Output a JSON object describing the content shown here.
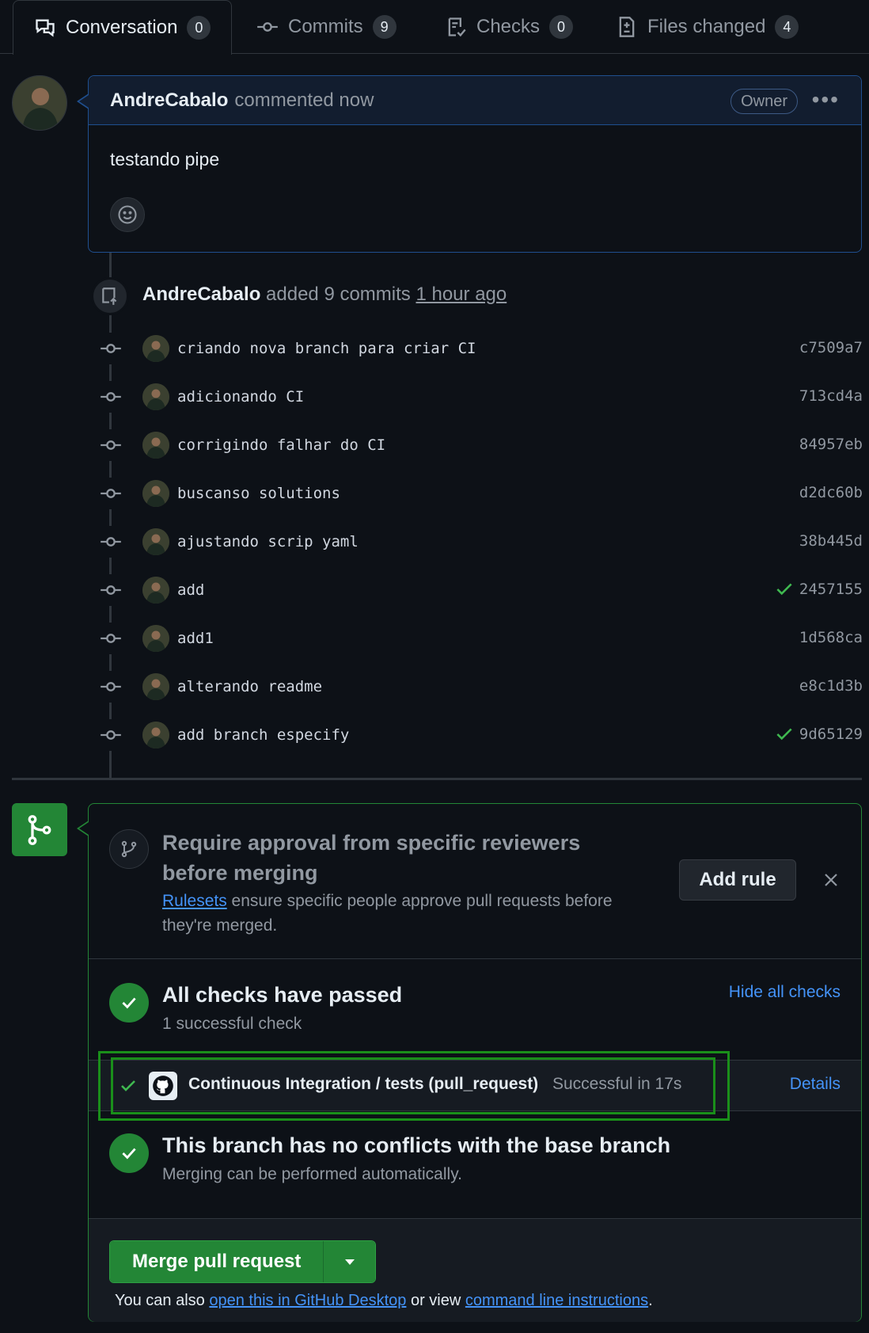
{
  "tabs": [
    {
      "label": "Conversation",
      "count": "0",
      "icon": "comment-discussion-icon"
    },
    {
      "label": "Commits",
      "count": "9",
      "icon": "git-commit-icon"
    },
    {
      "label": "Checks",
      "count": "0",
      "icon": "checklist-icon"
    },
    {
      "label": "Files changed",
      "count": "4",
      "icon": "file-diff-icon"
    }
  ],
  "comment": {
    "author": "AndreCabalo",
    "action": "commented now",
    "badge": "Owner",
    "body": "testando pipe"
  },
  "push_event": {
    "author": "AndreCabalo",
    "text": "added 9 commits",
    "time": "1 hour ago"
  },
  "commits": [
    {
      "message": "criando nova branch para criar CI",
      "sha": "c7509a7",
      "checked": false
    },
    {
      "message": "adicionando CI",
      "sha": "713cd4a",
      "checked": false
    },
    {
      "message": "corrigindo falhar do CI",
      "sha": "84957eb",
      "checked": false
    },
    {
      "message": "buscanso solutions",
      "sha": "d2dc60b",
      "checked": false
    },
    {
      "message": "ajustando scrip yaml",
      "sha": "38b445d",
      "checked": false
    },
    {
      "message": "add",
      "sha": "2457155",
      "checked": true
    },
    {
      "message": "add1",
      "sha": "1d568ca",
      "checked": false
    },
    {
      "message": "alterando readme",
      "sha": "e8c1d3b",
      "checked": false
    },
    {
      "message": "add branch especify",
      "sha": "9d65129",
      "checked": true
    }
  ],
  "merge_box": {
    "rule": {
      "title": "Require approval from specific reviewers before merging",
      "link_text": "Rulesets",
      "desc_rest": " ensure specific people approve pull requests before they're merged.",
      "add_rule_label": "Add rule"
    },
    "checks": {
      "title": "All checks have passed",
      "subtitle": "1 successful check",
      "hide_label": "Hide all checks"
    },
    "ci": {
      "name": "Continuous Integration / tests (pull_request)",
      "status": "Successful in 17s",
      "details_label": "Details"
    },
    "conflicts": {
      "title": "This branch has no conflicts with the base branch",
      "subtitle": "Merging can be performed automatically."
    },
    "merge": {
      "button_label": "Merge pull request",
      "note_prefix": "You can also ",
      "desktop_link": "open this in GitHub Desktop",
      "note_middle": " or view ",
      "cli_link": "command line instructions",
      "note_suffix": "."
    }
  },
  "colors": {
    "background": "#0d1117",
    "accent_green": "#238636",
    "link_blue": "#4493f8",
    "highlight_box": "#1a8f1a"
  }
}
